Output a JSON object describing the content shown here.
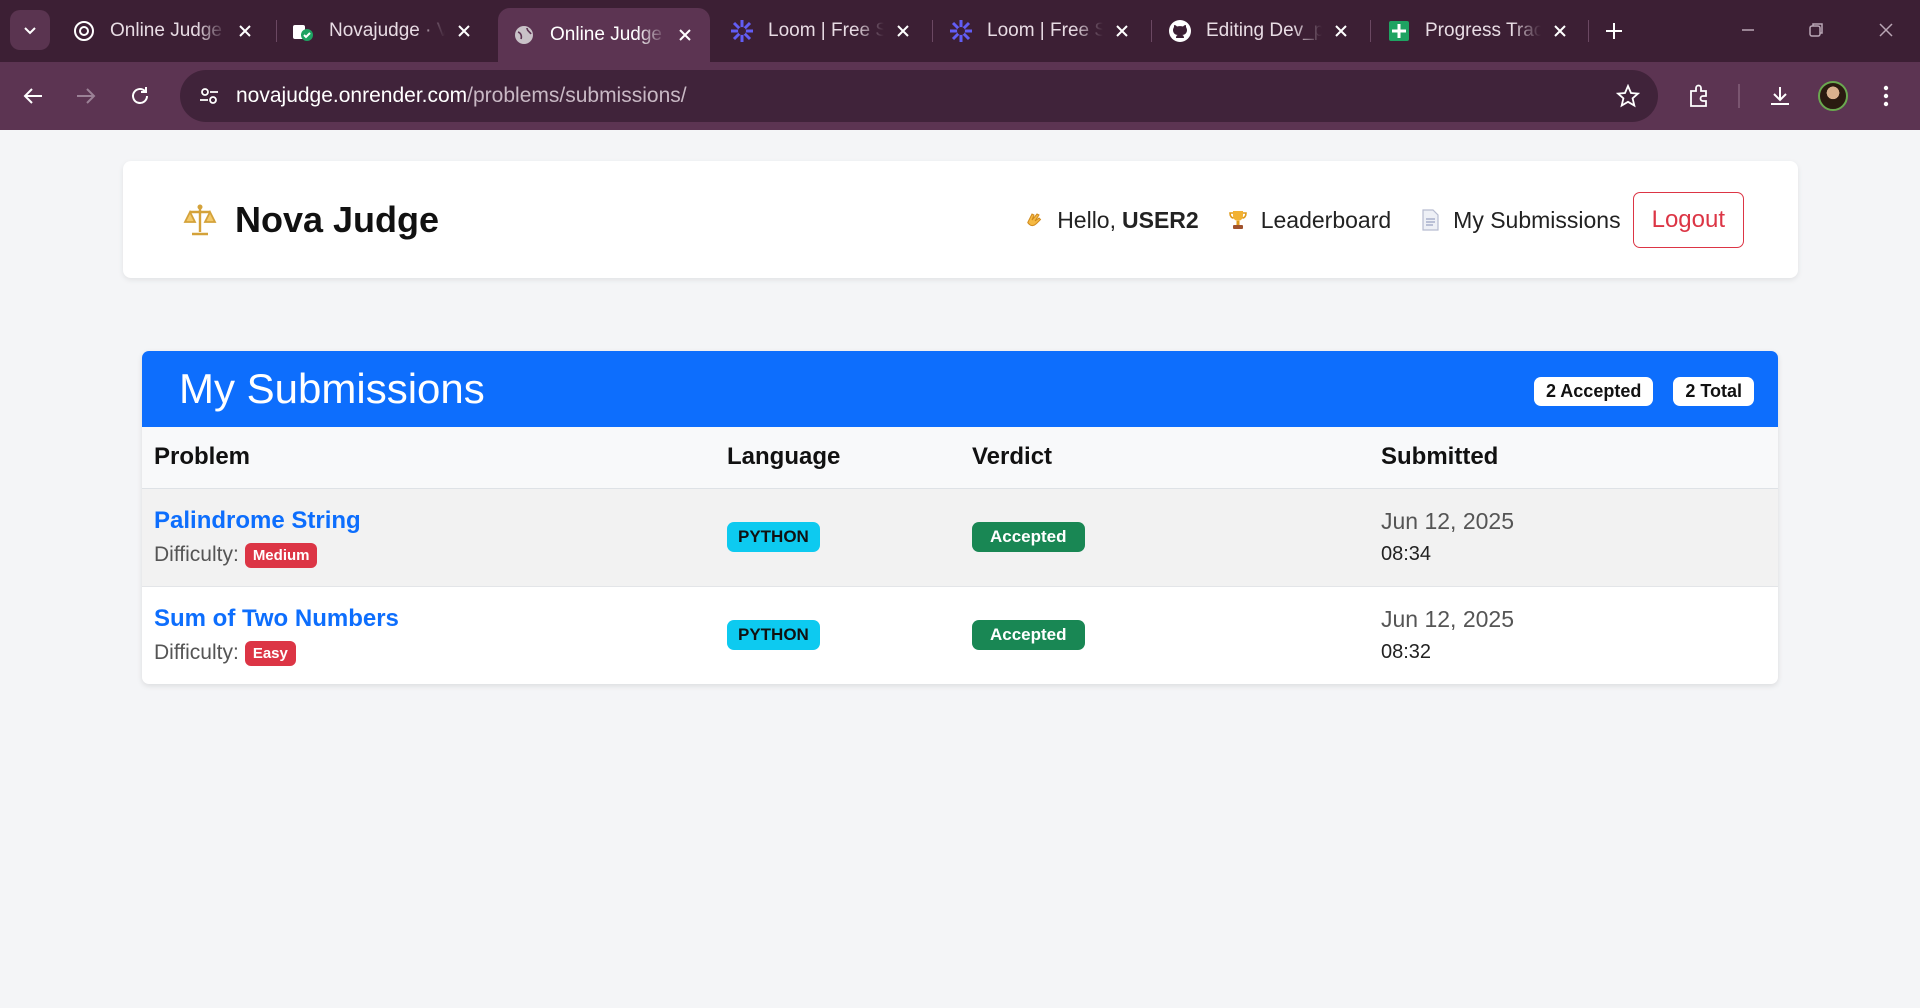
{
  "browser": {
    "tabs": [
      {
        "label": "Online Judge",
        "icon": "openai-icon"
      },
      {
        "label": "Novajudge · V",
        "icon": "render-deploy-icon"
      },
      {
        "label": "Online Judge",
        "icon": "globe-icon",
        "active": true
      },
      {
        "label": "Loom | Free Sc",
        "icon": "loom-icon"
      },
      {
        "label": "Loom | Free Sc",
        "icon": "loom-icon"
      },
      {
        "label": "Editing Dev_p",
        "icon": "github-icon"
      },
      {
        "label": "Progress Track",
        "icon": "sheets-icon"
      }
    ],
    "url_host": "novajudge.onrender.com",
    "url_path": "/problems/submissions/"
  },
  "navbar": {
    "brand": "Nova Judge",
    "greeting": "Hello,",
    "username": "USER2",
    "leaderboard": "Leaderboard",
    "my_submissions": "My Submissions",
    "logout": "Logout"
  },
  "submissions": {
    "title": "My Submissions",
    "accepted_badge": "2 Accepted",
    "total_badge": "2 Total",
    "columns": [
      "Problem",
      "Language",
      "Verdict",
      "Submitted"
    ],
    "difficulty_label": "Difficulty:",
    "rows": [
      {
        "problem": "Palindrome String",
        "difficulty": "Medium",
        "language": "PYTHON",
        "verdict": "Accepted",
        "date": "Jun 12, 2025",
        "time": "08:34"
      },
      {
        "problem": "Sum of Two Numbers",
        "difficulty": "Easy",
        "language": "PYTHON",
        "verdict": "Accepted",
        "date": "Jun 12, 2025",
        "time": "08:32"
      }
    ]
  },
  "colors": {
    "primary": "#0d6efd",
    "danger": "#dc3545",
    "success": "#198754",
    "info": "#0dcaf0",
    "chrome_frame": "#3c1f34",
    "chrome_toolbar": "#5c3452"
  }
}
